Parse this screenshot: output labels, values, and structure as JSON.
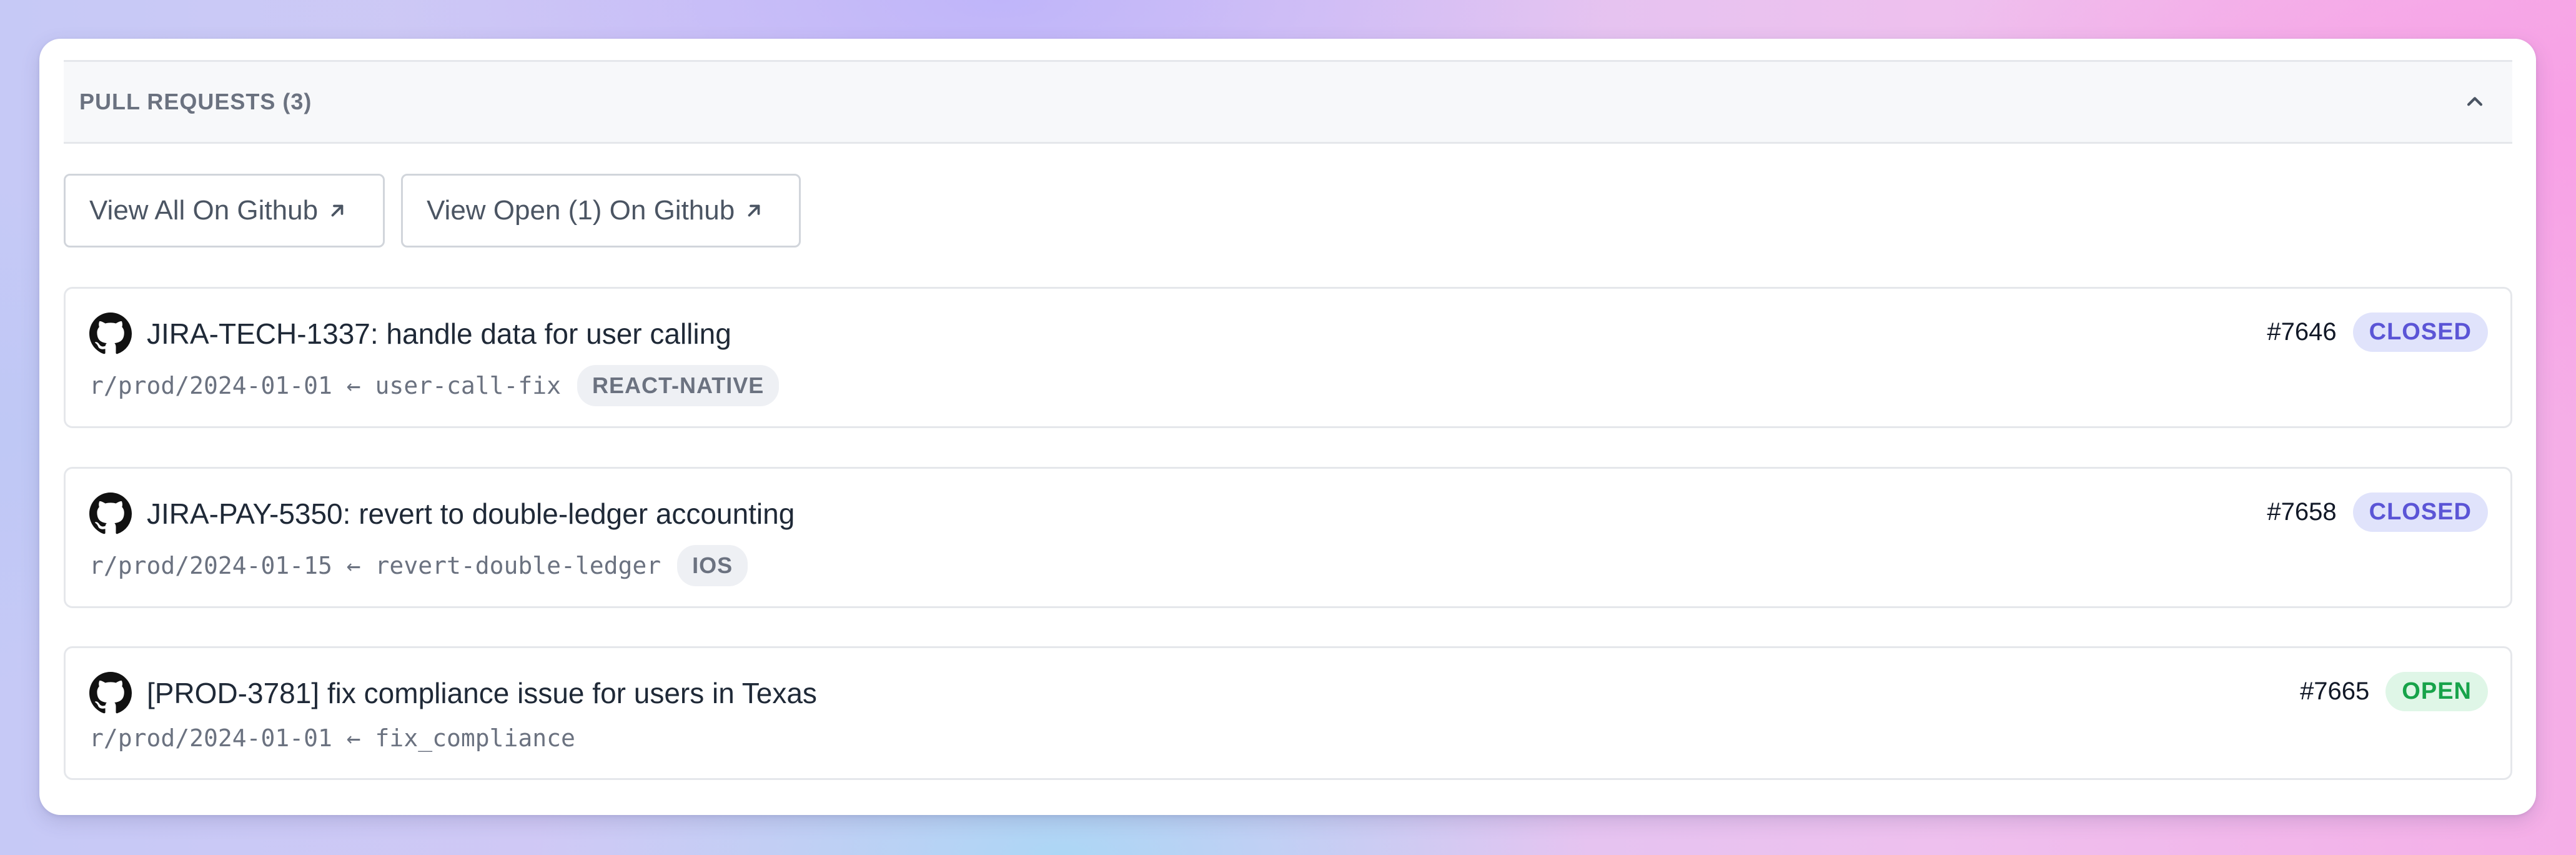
{
  "section": {
    "title": "PULL REQUESTS (3)"
  },
  "buttons": {
    "view_all": "View All On Github",
    "view_open": "View Open (1) On Github"
  },
  "pull_requests": [
    {
      "title": "JIRA-TECH-1337: handle data for user calling",
      "branch": "r/prod/2024-01-01 ← user-call-fix",
      "tag": "REACT-NATIVE",
      "number": "#7646",
      "status": "CLOSED"
    },
    {
      "title": "JIRA-PAY-5350: revert to double-ledger accounting",
      "branch": "r/prod/2024-01-15 ← revert-double-ledger",
      "tag": "IOS",
      "number": "#7658",
      "status": "CLOSED"
    },
    {
      "title": "[PROD-3781] fix compliance issue for users in Texas",
      "branch": "r/prod/2024-01-01 ← fix_compliance",
      "number": "#7665",
      "status": "OPEN"
    }
  ],
  "colors": {
    "closed_text": "#5b55d6",
    "closed_bg": "#e0e3fb",
    "open_text": "#17a34a",
    "open_bg": "#dff6e7"
  },
  "icons": {
    "collapse": "chevron-up-icon",
    "external": "arrow-up-right-icon",
    "pr": "github-icon"
  }
}
